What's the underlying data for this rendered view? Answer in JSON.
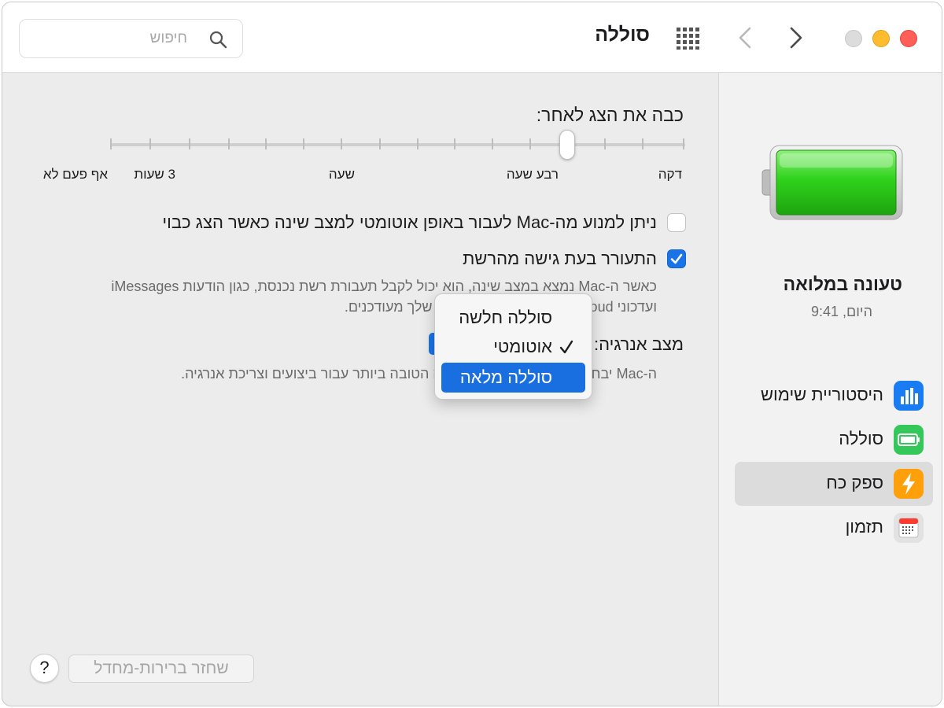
{
  "window": {
    "title": "סוללה"
  },
  "search": {
    "placeholder": "חיפוש"
  },
  "sidebar": {
    "battery_status": "טעונה במלואה",
    "battery_time": "היום, 9:41",
    "items": [
      {
        "label": "היסטוריית שימוש",
        "icon": "bar-chart-icon",
        "color": "#1a7cf2"
      },
      {
        "label": "סוללה",
        "icon": "battery-icon",
        "color": "#34c759"
      },
      {
        "label": "ספק כח",
        "icon": "lightning-bolt-icon",
        "color": "#ff9f0a",
        "selected": true
      },
      {
        "label": "תזמון",
        "icon": "calendar-icon",
        "color": "#ff3b30"
      }
    ]
  },
  "display_off": {
    "title": "כבה את הצג לאחר:",
    "labels": [
      "דקה",
      "רבע שעה",
      "שעה",
      "3 שעות",
      "אף פעם לא"
    ]
  },
  "options": {
    "prevent_sleep": {
      "label": "ניתן למנוע מה-Mac לעבור באופן אוטומטי למצב שינה כאשר הצג כבוי",
      "checked": false
    },
    "wake_network": {
      "label": "התעורר בעת גישה מהרשת",
      "checked": true,
      "desc_line1": "כאשר ה-Mac נמצא במצב שינה, הוא יכול לקבל תעבורת רשת נכנסת, כגון הודעות iMessages",
      "desc_line2": "ועדכוני iCloud אחרים, כדי שהיישומים שלך מעודכנים."
    },
    "energy_mode": {
      "label": "מצב אנרגיה:",
      "desc": "ה-Mac יבחר באופן אוטומטי את הרמה הטובה ביותר עבור ביצועים וצריכת אנרגיה."
    }
  },
  "menu": {
    "items": [
      {
        "label": "סוללה חלשה"
      },
      {
        "label": "אוטומטי",
        "checked": true
      },
      {
        "label": "סוללה מלאה",
        "highlighted": true
      }
    ]
  },
  "footer": {
    "restore_label": "שחזר ברירות-מחדל",
    "help_label": "?"
  },
  "colors": {
    "accent": "#1a74e8",
    "close": "#ff5f57",
    "minimize": "#febc2e"
  }
}
